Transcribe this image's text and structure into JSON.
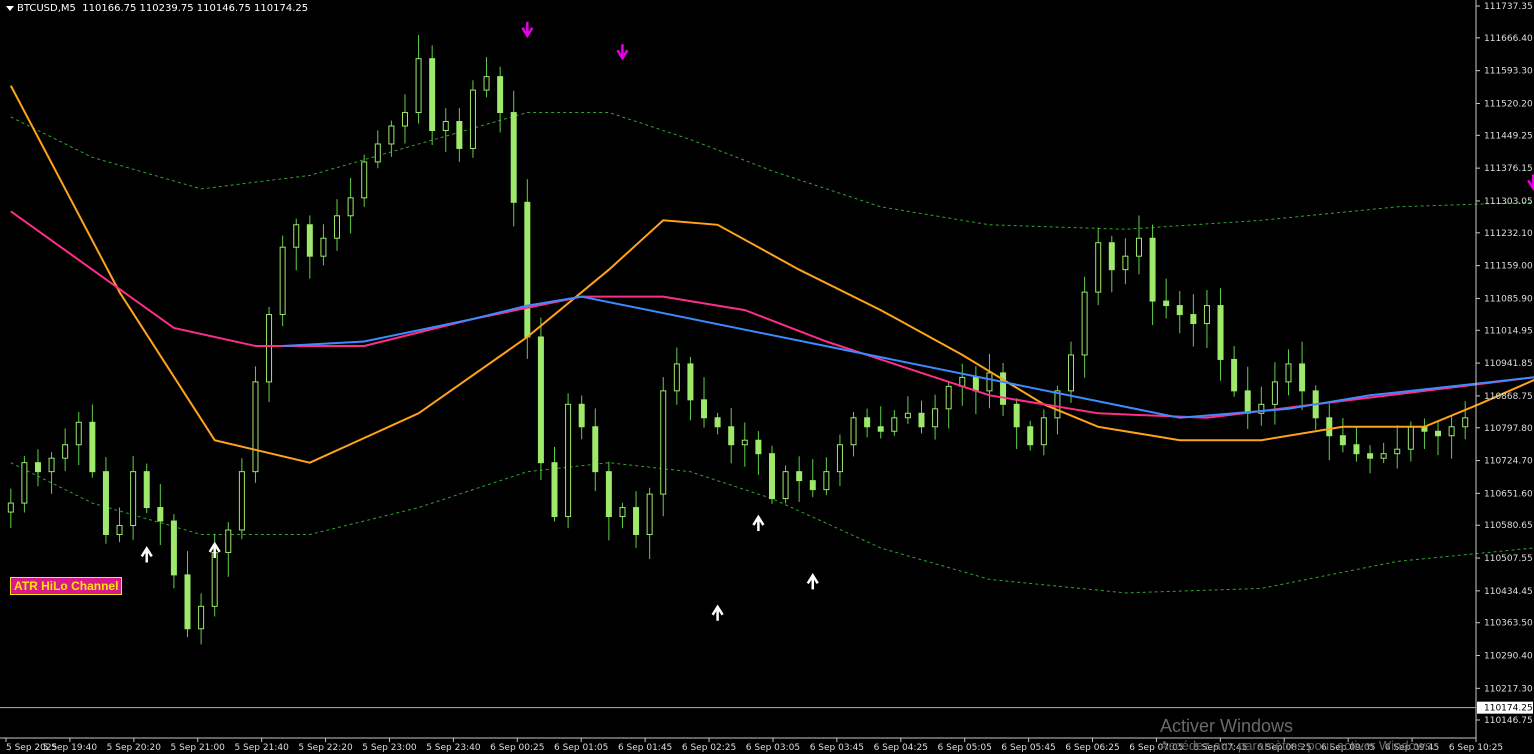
{
  "header": {
    "symbol": "BTCUSD,M5",
    "ohlc": "110166.75 110239.75 110146.75 110174.25"
  },
  "indicator_label": "ATR HiLo Channel",
  "watermark": {
    "line1": "Activer Windows",
    "line2": "Accédez aux paramètres pour activer Windows."
  },
  "colors": {
    "background": "#000000",
    "candle": "#9ee86b",
    "wick": "#5fd04a",
    "ema_fast": "#ffa31a",
    "ma_slow_pink": "#ff2d8a",
    "ma_slow_blue": "#3c8cff",
    "channel": "#2fa52f",
    "sell_arrow": "#e800e8",
    "buy_arrow": "#ffffff",
    "price_line": "#b0b0b0"
  },
  "chart_data": {
    "type": "candlestick",
    "title": "BTCUSD,M5",
    "timeframe": "M5",
    "ylim": [
      110146.75,
      111737.35
    ],
    "y_ticks": [
      "111737.35",
      "111666.40",
      "111593.30",
      "111520.20",
      "111449.25",
      "111376.15",
      "111303.05",
      "111232.10",
      "111159.00",
      "111085.90",
      "111014.95",
      "110941.85",
      "110868.75",
      "110797.80",
      "110724.70",
      "110651.60",
      "110580.65",
      "110507.55",
      "110434.45",
      "110363.50",
      "110290.40",
      "110217.30",
      "110146.75"
    ],
    "current_price": "110174.25",
    "x_ticks": [
      "5 Sep 2025",
      "5 Sep 19:40",
      "5 Sep 20:20",
      "5 Sep 21:00",
      "5 Sep 21:40",
      "5 Sep 22:20",
      "5 Sep 23:00",
      "5 Sep 23:40",
      "6 Sep 00:25",
      "6 Sep 01:05",
      "6 Sep 01:45",
      "6 Sep 02:25",
      "6 Sep 03:05",
      "6 Sep 03:45",
      "6 Sep 04:25",
      "6 Sep 05:05",
      "6 Sep 05:45",
      "6 Sep 06:25",
      "6 Sep 07:05",
      "6 Sep 07:45",
      "6 Sep 08:25",
      "6 Sep 09:05",
      "6 Sep 09:45",
      "6 Sep 10:25"
    ],
    "close_path": [
      110630,
      110720,
      110700,
      110730,
      110760,
      110810,
      110700,
      110560,
      110580,
      110700,
      110620,
      110590,
      110470,
      110350,
      110400,
      110520,
      110570,
      110700,
      110900,
      111050,
      111200,
      111250,
      111180,
      111220,
      111270,
      111310,
      111390,
      111430,
      111470,
      111500,
      111620,
      111460,
      111480,
      111420,
      111550,
      111580,
      111500,
      111300,
      111000,
      110720,
      110600,
      110850,
      110800,
      110700,
      110600,
      110620,
      110560,
      110650,
      110880,
      110940,
      110860,
      110820,
      110800,
      110760,
      110770,
      110740,
      110640,
      110700,
      110680,
      110660,
      110700,
      110760,
      110820,
      110800,
      110790,
      110820,
      110830,
      110800,
      110840,
      110890,
      110910,
      110880,
      110920,
      110850,
      110800,
      110760,
      110820,
      110880,
      110960,
      111100,
      111210,
      111150,
      111180,
      111220,
      111080,
      111070,
      111050,
      111030,
      111070,
      110950,
      110880,
      110830,
      110850,
      110900,
      110940,
      110880,
      110820,
      110780,
      110760,
      110740,
      110730,
      110740,
      110750,
      110800,
      110790,
      110780,
      110800,
      110820
    ],
    "series": [
      {
        "name": "",
        "color": "#ffa31a",
        "points": [
          [
            0,
            111560
          ],
          [
            8,
            111100
          ],
          [
            15,
            110770
          ],
          [
            22,
            110720
          ],
          [
            30,
            110830
          ],
          [
            38,
            111000
          ],
          [
            44,
            111150
          ],
          [
            48,
            111260
          ],
          [
            52,
            111250
          ],
          [
            58,
            111150
          ],
          [
            64,
            111060
          ],
          [
            70,
            110960
          ],
          [
            76,
            110850
          ],
          [
            80,
            110800
          ],
          [
            86,
            110770
          ],
          [
            92,
            110770
          ],
          [
            98,
            110800
          ],
          [
            104,
            110800
          ],
          [
            108,
            110850
          ],
          [
            114,
            110930
          ],
          [
            118,
            110990
          ],
          [
            124,
            110990
          ],
          [
            132,
            110960
          ],
          [
            140,
            110880
          ],
          [
            148,
            110830
          ],
          [
            152,
            110810
          ]
        ]
      },
      {
        "name": "",
        "color": "#ff2d8a",
        "points": [
          [
            0,
            111280
          ],
          [
            6,
            111150
          ],
          [
            12,
            111020
          ],
          [
            18,
            110980
          ],
          [
            26,
            110980
          ],
          [
            34,
            111040
          ],
          [
            42,
            111090
          ],
          [
            48,
            111090
          ],
          [
            54,
            111060
          ],
          [
            60,
            110990
          ],
          [
            66,
            110930
          ],
          [
            72,
            110870
          ],
          [
            80,
            110830
          ],
          [
            88,
            110820
          ],
          [
            96,
            110850
          ],
          [
            104,
            110880
          ],
          [
            112,
            110910
          ],
          [
            120,
            110910
          ],
          [
            128,
            110900
          ],
          [
            136,
            110870
          ],
          [
            144,
            110840
          ],
          [
            152,
            110810
          ]
        ]
      },
      {
        "name": "",
        "color": "#3c8cff",
        "points": [
          [
            20,
            110980
          ],
          [
            26,
            110990
          ],
          [
            34,
            111040
          ],
          [
            38,
            111070
          ],
          [
            42,
            111090
          ],
          [
            86,
            110820
          ],
          [
            94,
            110840
          ],
          [
            100,
            110870
          ],
          [
            106,
            110890
          ],
          [
            112,
            110910
          ],
          [
            118,
            110910
          ]
        ]
      },
      {
        "name": "",
        "color": "#2fa52f",
        "dashed": true,
        "points": [
          [
            0,
            111490
          ],
          [
            6,
            111400
          ],
          [
            14,
            111330
          ],
          [
            22,
            111360
          ],
          [
            30,
            111430
          ],
          [
            38,
            111500
          ],
          [
            44,
            111500
          ],
          [
            50,
            111440
          ],
          [
            56,
            111370
          ],
          [
            64,
            111290
          ],
          [
            72,
            111250
          ],
          [
            82,
            111240
          ],
          [
            92,
            111260
          ],
          [
            102,
            111290
          ],
          [
            112,
            111300
          ],
          [
            120,
            111280
          ],
          [
            130,
            111230
          ],
          [
            142,
            111190
          ],
          [
            152,
            111160
          ]
        ]
      },
      {
        "name": "",
        "color": "#2fa52f",
        "dashed": true,
        "points": [
          [
            0,
            110720
          ],
          [
            6,
            110630
          ],
          [
            14,
            110560
          ],
          [
            22,
            110560
          ],
          [
            30,
            110620
          ],
          [
            38,
            110700
          ],
          [
            44,
            110720
          ],
          [
            50,
            110700
          ],
          [
            56,
            110640
          ],
          [
            64,
            110530
          ],
          [
            72,
            110460
          ],
          [
            82,
            110430
          ],
          [
            92,
            110440
          ],
          [
            102,
            110500
          ],
          [
            112,
            110530
          ],
          [
            120,
            110530
          ],
          [
            130,
            110500
          ],
          [
            142,
            110470
          ],
          [
            152,
            110460
          ]
        ]
      }
    ],
    "sell_arrows": [
      [
        38,
        111680
      ],
      [
        45,
        111630
      ],
      [
        112,
        111340
      ]
    ],
    "buy_arrows": [
      [
        10,
        110520
      ],
      [
        15,
        110530
      ],
      [
        52,
        110390
      ],
      [
        55,
        110590
      ],
      [
        59,
        110460
      ]
    ]
  }
}
